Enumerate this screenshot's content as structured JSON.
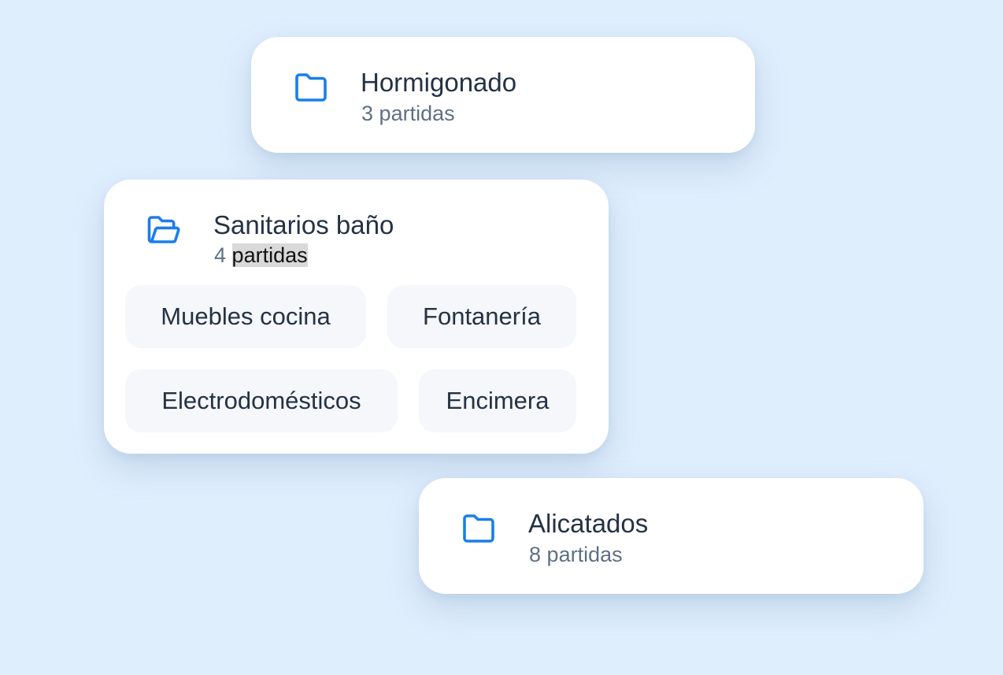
{
  "colors": {
    "background": "#dfeefd",
    "card": "#ffffff",
    "icon_accent": "#1a7ee8",
    "title": "#243244",
    "subtitle": "#5f7085",
    "chip_background": "#f5f7fa"
  },
  "folders": [
    {
      "title": "Hormigonado",
      "count": "3",
      "unit": "partidas",
      "icon": "folder-icon",
      "expanded": false
    },
    {
      "title": "Sanitarios baño",
      "count": "4",
      "unit": "partidas",
      "icon": "folder-open-icon",
      "expanded": true,
      "items": [
        "Muebles cocina",
        "Fontanería",
        "Electrodomésticos",
        "Encimera"
      ]
    },
    {
      "title": "Alicatados",
      "count": "8",
      "unit": "partidas",
      "icon": "folder-icon",
      "expanded": false
    }
  ]
}
